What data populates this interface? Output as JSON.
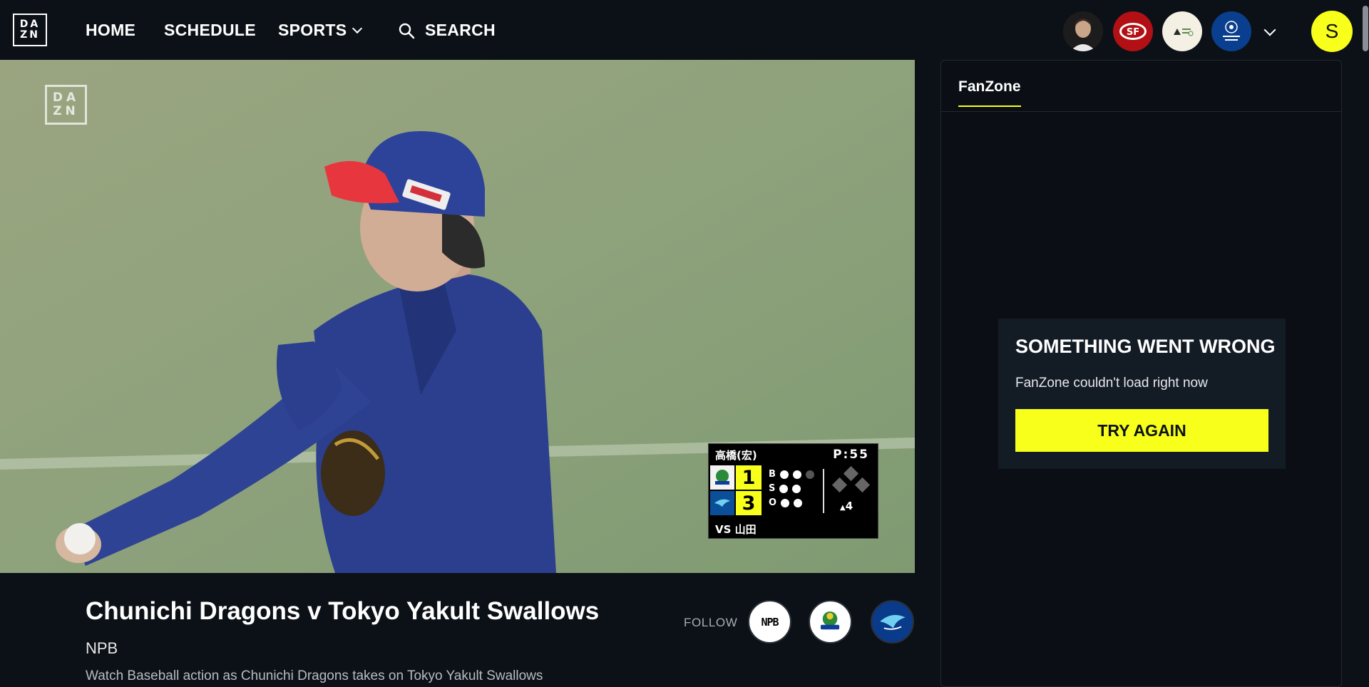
{
  "nav": {
    "logo": [
      "DA",
      "ZN"
    ],
    "home": "HOME",
    "schedule": "SCHEDULE",
    "sports": "SPORTS",
    "search": "SEARCH"
  },
  "favorites": [
    "athlete",
    "49ers",
    "tournament",
    "champions-league"
  ],
  "user": {
    "initial": "S"
  },
  "video": {
    "watermark": [
      "DA",
      "ZN"
    ],
    "scoreboard": {
      "pitcher": "高橋(宏)",
      "pitch_count": "P:55",
      "team1_score": "1",
      "team2_score": "3",
      "balls_label": "B",
      "strikes_label": "S",
      "outs_label": "O",
      "balls": 2,
      "strikes": 2,
      "outs": 2,
      "inning": "4",
      "batter": "VS 山田"
    }
  },
  "event": {
    "title": "Chunichi Dragons v Tokyo Yakult Swallows",
    "league": "NPB",
    "description": "Watch Baseball action as Chunichi Dragons takes on Tokyo Yakult Swallows"
  },
  "follow": {
    "label": "FOLLOW",
    "npb_label": "NPB"
  },
  "fanzone": {
    "tab": "FanZone",
    "error_heading": "SOMETHING WENT WRONG",
    "error_message": "FanZone couldn't load right now",
    "retry_label": "TRY AGAIN"
  },
  "colors": {
    "accent": "#f7ff1a",
    "background": "#0c1117",
    "card": "#131b25"
  }
}
